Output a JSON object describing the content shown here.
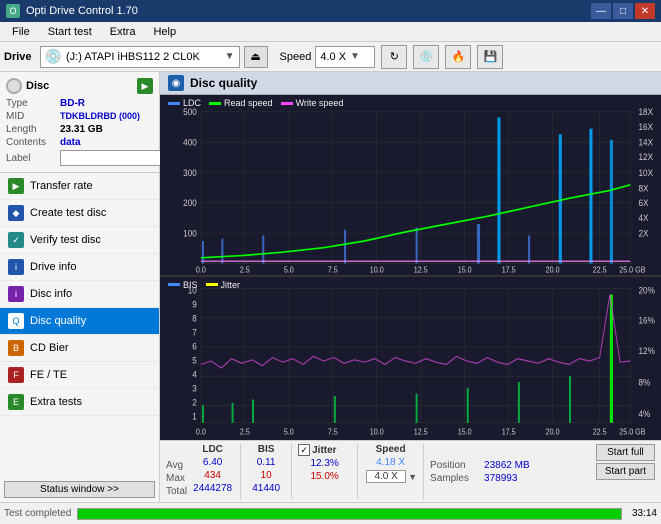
{
  "app": {
    "title": "Opti Drive Control 1.70",
    "icon": "O"
  },
  "titlebar": {
    "minimize": "—",
    "maximize": "□",
    "close": "✕"
  },
  "menubar": {
    "items": [
      "File",
      "Start test",
      "Extra",
      "Help"
    ]
  },
  "drive_toolbar": {
    "drive_label": "Drive",
    "drive_value": "(J:)  ATAPI iHBS112  2 CL0K",
    "speed_label": "Speed",
    "speed_value": "4.0 X"
  },
  "sidebar": {
    "disc": {
      "title": "Disc",
      "type_label": "Type",
      "type_value": "BD-R",
      "mid_label": "MID",
      "mid_value": "TDKBLDRBD (000)",
      "length_label": "Length",
      "length_value": "23.31 GB",
      "contents_label": "Contents",
      "contents_value": "data",
      "label_label": "Label"
    },
    "nav_items": [
      {
        "id": "transfer-rate",
        "label": "Transfer rate",
        "icon": "▶",
        "color": "green",
        "active": false
      },
      {
        "id": "create-test-disc",
        "label": "Create test disc",
        "icon": "◆",
        "color": "blue",
        "active": false
      },
      {
        "id": "verify-test-disc",
        "label": "Verify test disc",
        "icon": "✓",
        "color": "teal",
        "active": false
      },
      {
        "id": "drive-info",
        "label": "Drive info",
        "icon": "i",
        "color": "blue",
        "active": false
      },
      {
        "id": "disc-info",
        "label": "Disc info",
        "icon": "i",
        "color": "purple",
        "active": false
      },
      {
        "id": "disc-quality",
        "label": "Disc quality",
        "icon": "Q",
        "color": "active-icon",
        "active": true
      },
      {
        "id": "cd-bier",
        "label": "CD Bier",
        "icon": "B",
        "color": "orange",
        "active": false
      },
      {
        "id": "fe-te",
        "label": "FE / TE",
        "icon": "F",
        "color": "red",
        "active": false
      },
      {
        "id": "extra-tests",
        "label": "Extra tests",
        "icon": "E",
        "color": "green",
        "active": false
      }
    ],
    "status_btn": "Status window >>"
  },
  "content": {
    "header_title": "Disc quality",
    "chart_top": {
      "legend": [
        {
          "id": "ldc",
          "label": "LDC",
          "color": "blue"
        },
        {
          "id": "read-speed",
          "label": "Read speed",
          "color": "green"
        },
        {
          "id": "write-speed",
          "label": "Write speed",
          "color": "pink"
        }
      ],
      "y_max": 500,
      "y_labels_left": [
        "500",
        "400",
        "300",
        "200",
        "100",
        "0"
      ],
      "y_labels_right": [
        "18X",
        "16X",
        "14X",
        "12X",
        "10X",
        "8X",
        "6X",
        "4X",
        "2X"
      ],
      "x_labels": [
        "0.0",
        "2.5",
        "5.0",
        "7.5",
        "10.0",
        "12.5",
        "15.0",
        "17.5",
        "20.0",
        "22.5",
        "25.0 GB"
      ]
    },
    "chart_bottom": {
      "legend": [
        {
          "id": "bis",
          "label": "BIS",
          "color": "blue"
        },
        {
          "id": "jitter",
          "label": "Jitter",
          "color": "yellow"
        }
      ],
      "y_labels_left": [
        "10",
        "9",
        "8",
        "7",
        "6",
        "5",
        "4",
        "3",
        "2",
        "1"
      ],
      "y_labels_right": [
        "20%",
        "16%",
        "12%",
        "8%",
        "4%"
      ],
      "x_labels": [
        "0.0",
        "2.5",
        "5.0",
        "7.5",
        "10.0",
        "12.5",
        "15.0",
        "17.5",
        "20.0",
        "22.5",
        "25.0 GB"
      ]
    },
    "stats": {
      "col_headers": [
        "LDC",
        "BIS",
        "",
        "Jitter",
        "Speed"
      ],
      "avg_label": "Avg",
      "max_label": "Max",
      "total_label": "Total",
      "ldc_avg": "6.40",
      "ldc_max": "434",
      "ldc_total": "2444278",
      "bis_avg": "0.11",
      "bis_max": "10",
      "bis_total": "41440",
      "jitter_avg": "12.3%",
      "jitter_max": "15.0%",
      "speed_avg": "4.18 X",
      "speed_max": "4.0 X",
      "position_label": "Position",
      "position_value": "23862 MB",
      "samples_label": "Samples",
      "samples_value": "378993",
      "start_full": "Start full",
      "start_part": "Start part"
    }
  },
  "statusbar": {
    "status_window_btn": "Status window >>",
    "status_text": "Test completed",
    "progress": 100,
    "time": "33:14"
  }
}
